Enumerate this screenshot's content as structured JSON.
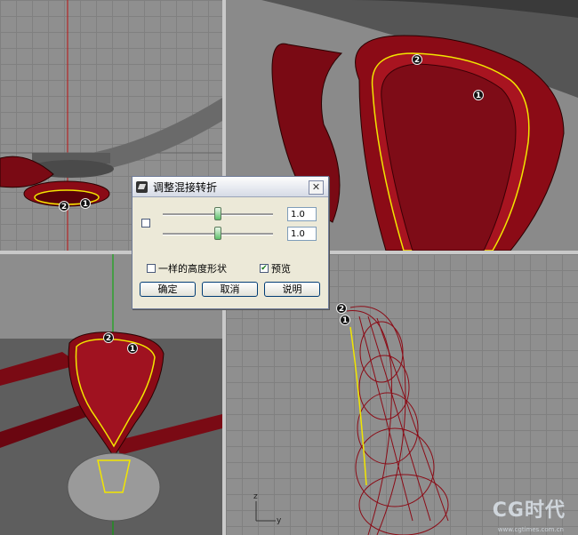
{
  "dialog": {
    "title": "调整混接转折",
    "close_glyph": "✕",
    "slider1_value": "1.0",
    "slider2_value": "1.0",
    "same_height_label": "一样的高度形状",
    "same_height_checked": false,
    "preview_label": "预览",
    "preview_checked": true,
    "ok_label": "确定",
    "cancel_label": "取消",
    "help_label": "说明"
  },
  "markers": {
    "one": "1",
    "two": "2"
  },
  "axis": {
    "z": "z",
    "y": "y"
  },
  "watermark": {
    "main": "CG时代",
    "sub": "www.cgtimes.com.cn"
  },
  "colors": {
    "surface_red": "#8b0b16",
    "curve_yellow": "#f2e600",
    "viewport_bg": "#8f8f8f"
  }
}
